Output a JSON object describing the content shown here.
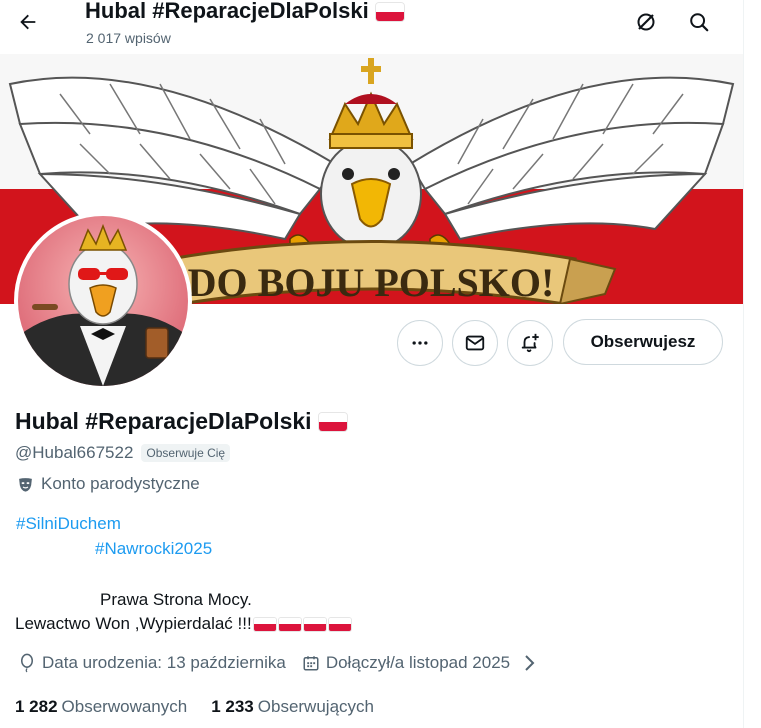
{
  "header": {
    "title": "Hubal #ReparacjeDlaPolski",
    "posts_count": "2 017 wpisów"
  },
  "banner": {
    "text": "DO BOJU POLSKO!"
  },
  "actions": {
    "follow_label": "Obserwujesz"
  },
  "profile": {
    "display_name": "Hubal #ReparacjeDlaPolski",
    "handle": "@Hubal667522",
    "follows_you": "Obserwuje Cię",
    "parody_label": "Konto parodystyczne",
    "bio": {
      "hashtag1": "#SilniDuchem",
      "hashtag2": "#Nawrocki2025",
      "line1": "Prawa Strona Mocy.",
      "line2": "Lewactwo Won  ,Wypierdalać  !!!"
    },
    "birthday": "Data urodzenia: 13 października",
    "joined": "Dołączył/a listopad 2025"
  },
  "stats": {
    "following_count": "1 282",
    "following_label": "Obserwowanych",
    "followers_count": "1 233",
    "followers_label": "Obserwujących"
  },
  "colors": {
    "accent": "#1d9bf0",
    "text_primary": "#0f1419",
    "text_secondary": "#536471",
    "flag_red": "#dc143c",
    "border": "#cfd9de"
  },
  "icons": {
    "back": "arrow-left-icon",
    "grok": "grok-icon",
    "search": "search-icon",
    "more": "more-icon",
    "message": "envelope-icon",
    "notify": "bell-plus-icon",
    "parody": "mask-icon",
    "birthday": "balloon-icon",
    "joined": "calendar-icon",
    "chevron": "chevron-right-icon"
  }
}
